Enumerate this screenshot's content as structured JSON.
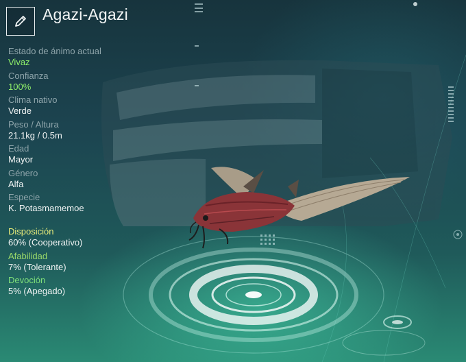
{
  "creature": {
    "name": "Agazi-Agazi"
  },
  "stats": [
    {
      "label": "Estado de ánimo actual",
      "value": "Vivaz",
      "highlight": true
    },
    {
      "label": "Confianza",
      "value": "100%",
      "highlight": true
    },
    {
      "label": "Clima nativo",
      "value": "Verde",
      "highlight": false
    },
    {
      "label": "Peso / Altura",
      "value": "21.1kg / 0.5m",
      "highlight": false
    },
    {
      "label": "Edad",
      "value": "Mayor",
      "highlight": false
    },
    {
      "label": "Género",
      "value": "Alfa",
      "highlight": false
    },
    {
      "label": "Especie",
      "value": "K. Potasmamemoe",
      "highlight": false
    }
  ],
  "traits": [
    {
      "label": "Disposición",
      "value": "60% (Cooperativo)"
    },
    {
      "label": "Afabilidad",
      "value": "7% (Tolerante)"
    },
    {
      "label": "Devoción",
      "value": "5% (Apegado)"
    }
  ],
  "icons": {
    "edit": "pencil-icon"
  },
  "colors": {
    "highlight_green": "#8ff06a",
    "disposition_yellow": "#e8ec7a",
    "affability_green": "#9ad96a",
    "devotion_green": "#7fe07a"
  }
}
